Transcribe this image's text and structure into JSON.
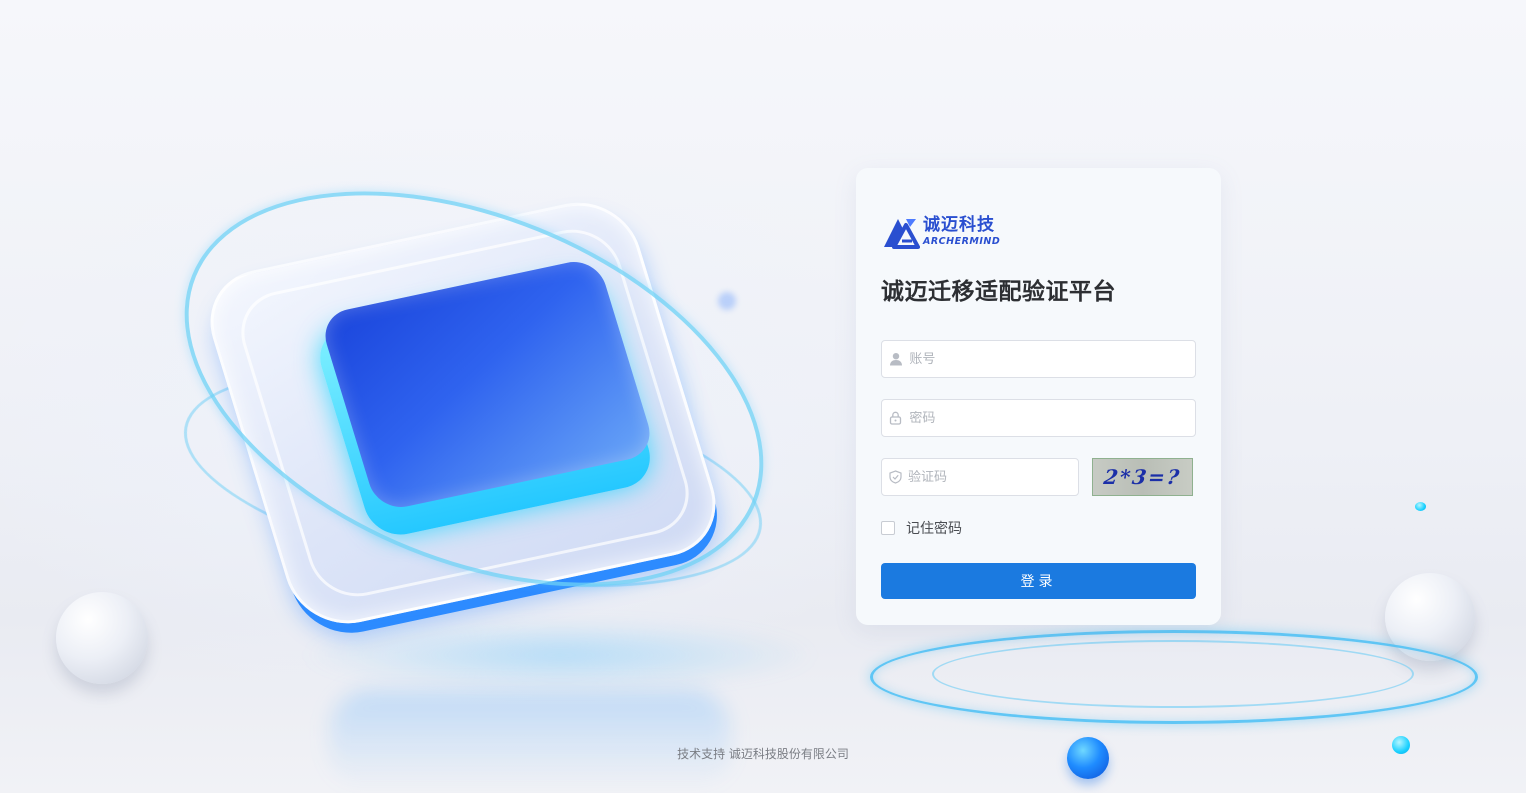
{
  "brand": {
    "name_cn": "诚迈科技",
    "name_en": "ARCHERMIND",
    "accent_color": "#2a4fd0"
  },
  "login": {
    "title": "诚迈迁移适配验证平台",
    "username": {
      "placeholder": "账号",
      "value": "",
      "icon": "user-icon"
    },
    "password": {
      "placeholder": "密码",
      "value": "",
      "icon": "lock-icon"
    },
    "captcha_input": {
      "placeholder": "验证码",
      "value": "",
      "icon": "shield-icon"
    },
    "captcha_text": "2*3=?",
    "remember_label": "记住密码",
    "remember_checked": false,
    "submit_label": "登录",
    "submit_color": "#1b7ae0"
  },
  "footer": {
    "text": "技术支持 诚迈科技股份有限公司"
  }
}
